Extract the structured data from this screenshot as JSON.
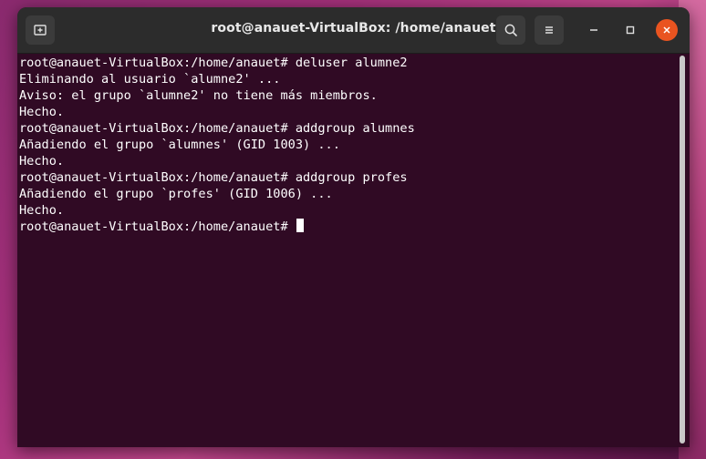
{
  "window": {
    "title": "root@anauet-VirtualBox: /home/anauet"
  },
  "toolbar": {
    "new_tab_icon": "new-tab-icon",
    "search_icon": "search-icon",
    "menu_icon": "hamburger-menu-icon"
  },
  "controls": {
    "minimize_icon": "minimize-icon",
    "maximize_icon": "maximize-icon",
    "close_icon": "close-icon",
    "close_color": "#e95420"
  },
  "terminal": {
    "background": "#300a24",
    "lines": [
      "root@anauet-VirtualBox:/home/anauet# deluser alumne2",
      "Eliminando al usuario `alumne2' ...",
      "Aviso: el grupo `alumne2' no tiene más miembros.",
      "Hecho.",
      "root@anauet-VirtualBox:/home/anauet# addgroup alumnes",
      "Añadiendo el grupo `alumnes' (GID 1003) ...",
      "Hecho.",
      "root@anauet-VirtualBox:/home/anauet# addgroup profes",
      "Añadiendo el grupo `profes' (GID 1006) ...",
      "Hecho.",
      "root@anauet-VirtualBox:/home/anauet# "
    ]
  }
}
